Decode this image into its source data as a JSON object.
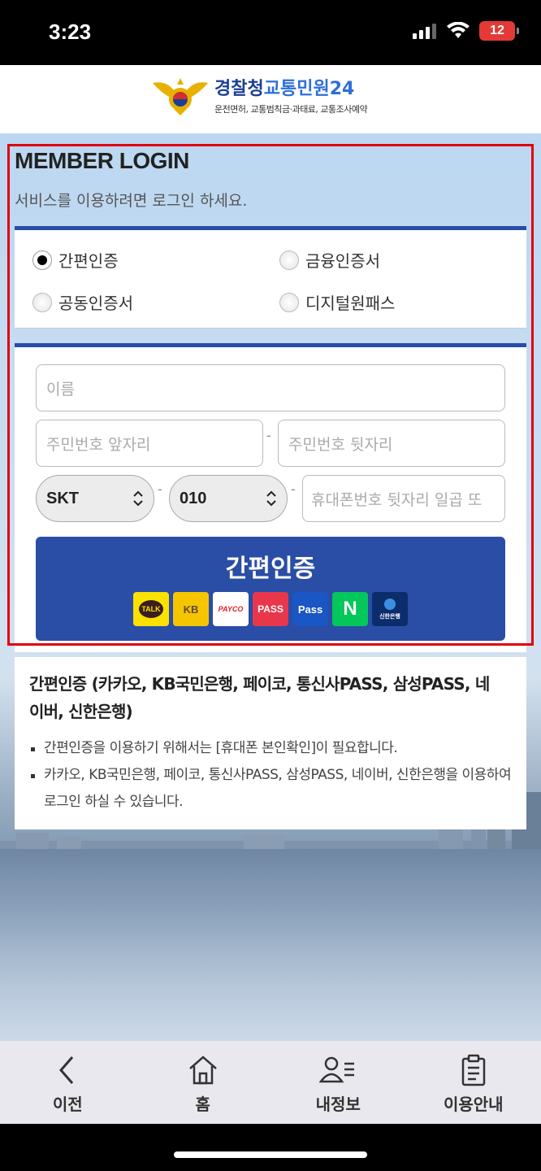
{
  "status_bar": {
    "time": "3:23",
    "battery": "12"
  },
  "header": {
    "logo_title_a": "경찰청",
    "logo_title_b": "교통민원24",
    "logo_subtitle": "운전면허, 교통범칙금·과태료, 교통조사예약"
  },
  "login": {
    "title": "MEMBER LOGIN",
    "subtitle": "서비스를 이용하려면 로그인 하세요."
  },
  "auth_options": [
    {
      "label": "간편인증",
      "selected": true
    },
    {
      "label": "금융인증서",
      "selected": false
    },
    {
      "label": "공동인증서",
      "selected": false
    },
    {
      "label": "디지털원패스",
      "selected": false
    }
  ],
  "form": {
    "name_placeholder": "이름",
    "rrn_front_placeholder": "주민번호 앞자리",
    "rrn_back_placeholder": "주민번호 뒷자리",
    "dash": "-",
    "carrier_value": "SKT",
    "prefix_value": "010",
    "phone_placeholder": "휴대폰번호 뒷자리 일곱 또"
  },
  "auth_button": {
    "label": "간편인증",
    "providers": [
      {
        "icon": "kakao-talk-icon",
        "text": "TALK",
        "bg": "#fae100",
        "fg": "#3a1d1d"
      },
      {
        "icon": "kb-bank-icon",
        "text": "KB",
        "bg": "#f5c500",
        "fg": "#5a4a3a"
      },
      {
        "icon": "payco-icon",
        "text": "PAYCO",
        "bg": "#ffffff",
        "fg": "#e0202c"
      },
      {
        "icon": "pass-icon",
        "text": "PASS",
        "bg": "#e8364b",
        "fg": "#ffffff"
      },
      {
        "icon": "samsung-pass-icon",
        "text": "Pass",
        "bg": "#1a56c4",
        "fg": "#ffffff"
      },
      {
        "icon": "naver-icon",
        "text": "N",
        "bg": "#03c75a",
        "fg": "#ffffff"
      },
      {
        "icon": "shinhan-bank-icon",
        "text": "신한은행",
        "bg": "#0c2d6b",
        "fg": "#ffffff"
      }
    ]
  },
  "info": {
    "title": "간편인증 (카카오, KB국민은행, 페이코, 통신사PASS, 삼성PASS, 네이버, 신한은행)",
    "items": [
      "간편인증을 이용하기 위해서는 [휴대폰 본인확인]이 필요합니다.",
      "카카오, KB국민은행, 페이코, 통신사PASS, 삼성PASS, 네이버, 신한은행을 이용하여 로그인 하실 수 있습니다."
    ]
  },
  "bottom_nav": [
    {
      "label": "이전",
      "icon": "back-arrow-icon"
    },
    {
      "label": "홈",
      "icon": "home-icon"
    },
    {
      "label": "내정보",
      "icon": "my-info-icon"
    },
    {
      "label": "이용안내",
      "icon": "guide-clipboard-icon"
    }
  ],
  "colors": {
    "brand_blue": "#2a4da6",
    "highlight_red": "#e0000f"
  }
}
